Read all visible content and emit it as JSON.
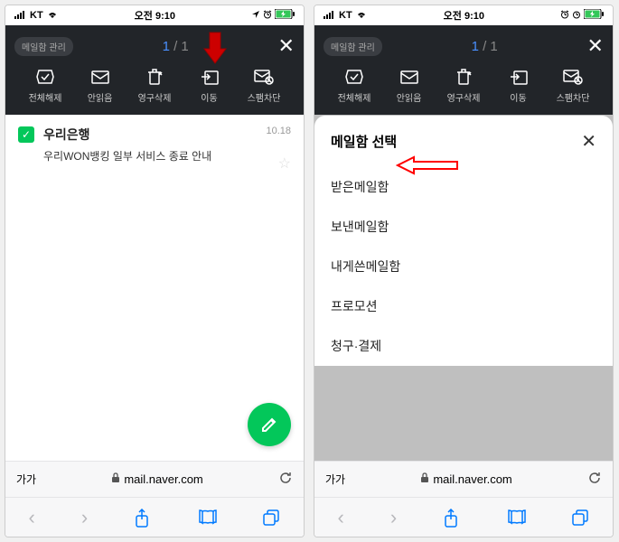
{
  "status": {
    "carrier": "KT",
    "time": "오전 9:10"
  },
  "header": {
    "badge": "메일함 관리",
    "count_current": "1",
    "count_total": "/ 1"
  },
  "actions": {
    "deselect": "전체해제",
    "unread": "안읽음",
    "delete": "영구삭제",
    "move": "이동",
    "spam": "스팸차단"
  },
  "mail": {
    "sender": "우리은행",
    "subject": "우리WON뱅킹 일부 서비스 종료 안내",
    "date": "10.18"
  },
  "sheet": {
    "title": "메일함 선택",
    "items": [
      "받은메일함",
      "보낸메일함",
      "내게쓴메일함",
      "프로모션",
      "청구·결제"
    ]
  },
  "safari": {
    "url": "mail.naver.com",
    "reader": "가가"
  }
}
